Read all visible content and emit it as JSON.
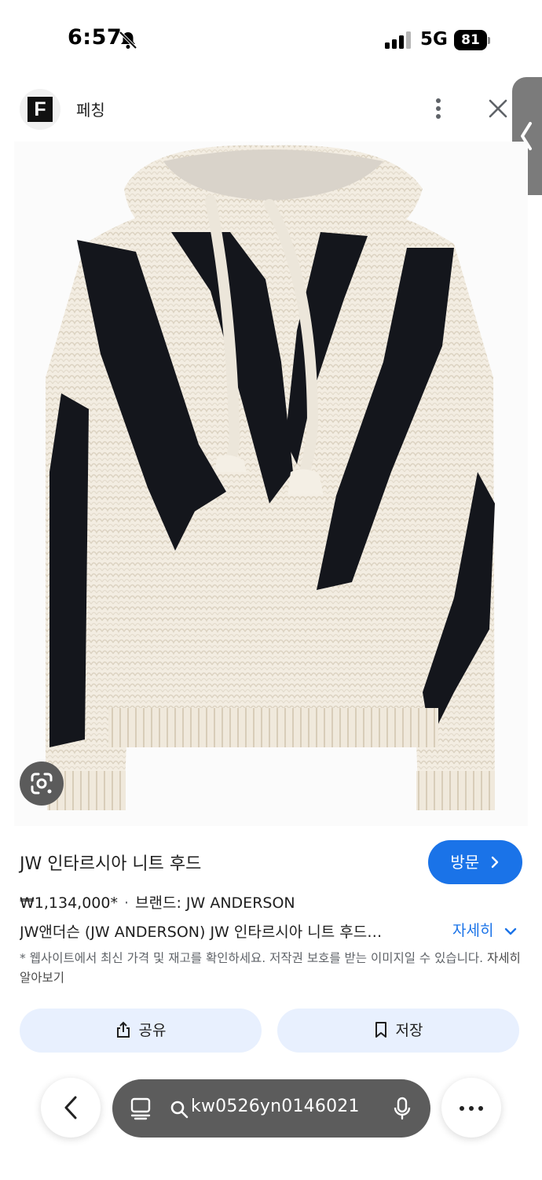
{
  "status": {
    "time": "6:57",
    "network": "5G",
    "battery": "81"
  },
  "source": {
    "logo_letter": "F",
    "name": "페칭"
  },
  "product": {
    "title": "JW 인타르시아 니트 후드",
    "price": "₩1,134,000*",
    "brand_label": "브랜드: JW ANDERSON",
    "description": "JW앤더슨 (JW ANDERSON) JW 인타르시아 니트 후드…",
    "detail_toggle": "자세히",
    "notice": "* 웹사이트에서 최신 가격 및 재고를 확인하세요. 저작권 보호를 받는 이미지일 수 있습니다.",
    "notice_link": "자세히 알아보기"
  },
  "buttons": {
    "visit": "방문",
    "share": "공유",
    "save": "저장"
  },
  "browser": {
    "url": "kw0526yn0146021"
  },
  "icons": [
    "bell-off-icon",
    "signal-icon",
    "more-vert-icon",
    "close-icon",
    "chevron-left-icon",
    "lens-icon",
    "chevron-right-icon",
    "chevron-down-icon",
    "share-icon",
    "bookmark-icon",
    "back-icon",
    "tabs-icon",
    "search-icon",
    "mic-icon",
    "more-horiz-icon"
  ],
  "colors": {
    "accent": "#1a73e8",
    "action_bg": "#e8f0fe",
    "url_bar": "#5c5c5c"
  }
}
